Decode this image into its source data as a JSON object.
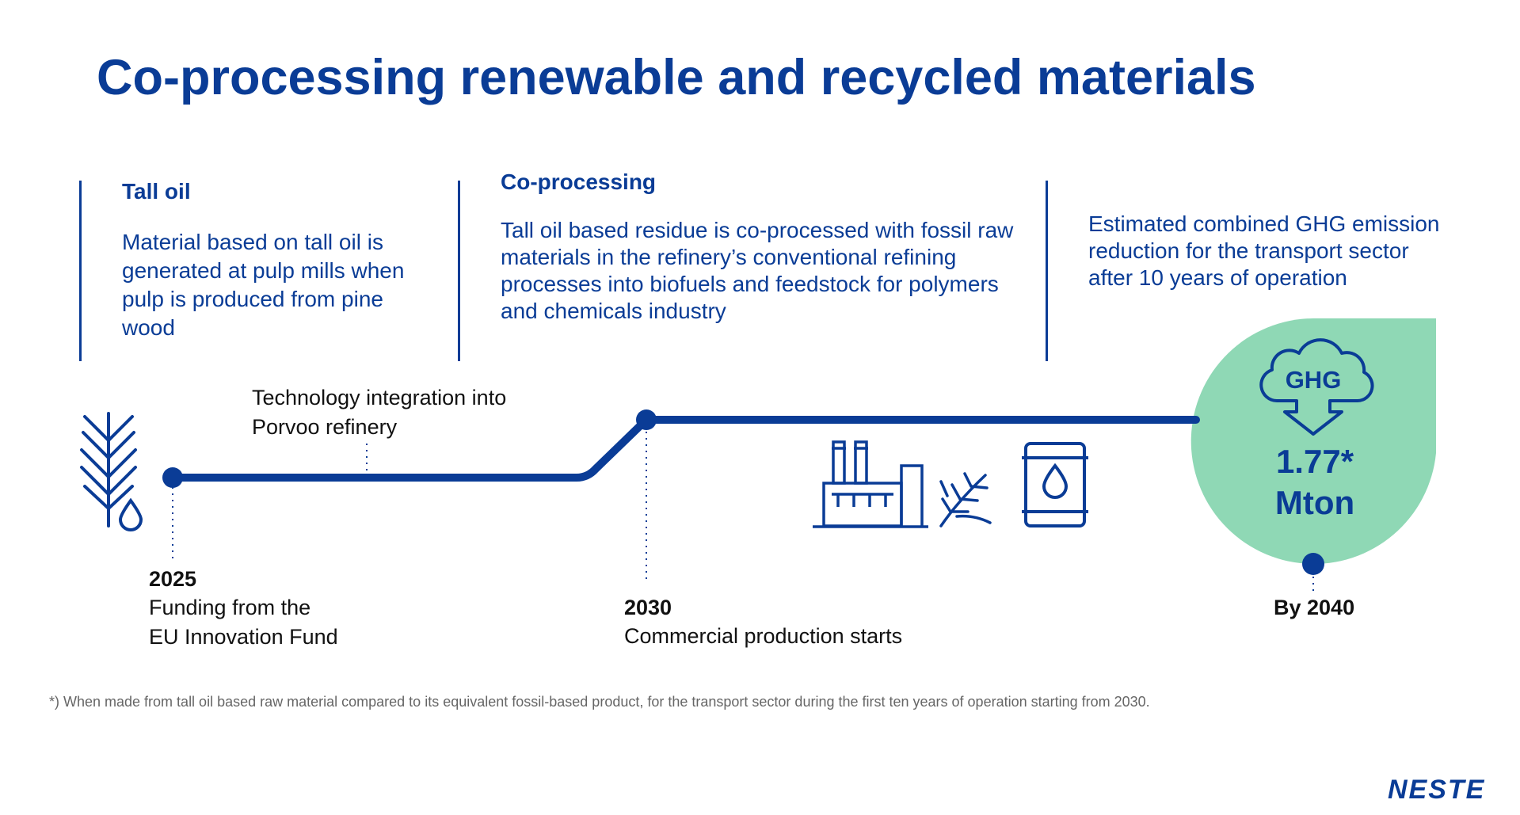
{
  "title": "Co-processing renewable and recycled materials",
  "columns": [
    {
      "heading": "Tall oil",
      "body": "Material based on tall oil is generated at pulp mills when pulp is produced from pine wood"
    },
    {
      "heading": "Co-processing",
      "body": "Tall oil based residue is co-processed with fossil raw materials in the refinery’s conventional refining processes into biofuels and feedstock for polymers and chemicals industry"
    },
    {
      "heading": "",
      "body": "Estimated combined GHG emission reduction for the transport sector after 10 years of operation"
    }
  ],
  "timeline": {
    "milestone_2025": {
      "year": "2025",
      "line1": "Funding from the",
      "line2": "EU Innovation Fund"
    },
    "integration": {
      "line1": "Technology integration into",
      "line2": "Porvoo refinery"
    },
    "milestone_2030": {
      "year": "2030",
      "desc": "Commercial production starts"
    },
    "milestone_2040": {
      "year": "By 2040"
    }
  },
  "ghg": {
    "word": "GHG",
    "value": "1.77*",
    "unit": "Mton"
  },
  "footnote": "*) When made from tall oil based raw material compared to its equivalent fossil-based product, for the transport sector during the first ten years of operation starting from 2030.",
  "logo": "NESTE",
  "colors": {
    "brand_blue": "#0a3c96",
    "ghg_green": "#8fd8b5"
  },
  "icons": [
    "pine-branch-icon",
    "oil-drop-icon",
    "factory-icon",
    "pine-twig-icon",
    "oil-barrel-icon",
    "cloud-arrow-icon"
  ]
}
